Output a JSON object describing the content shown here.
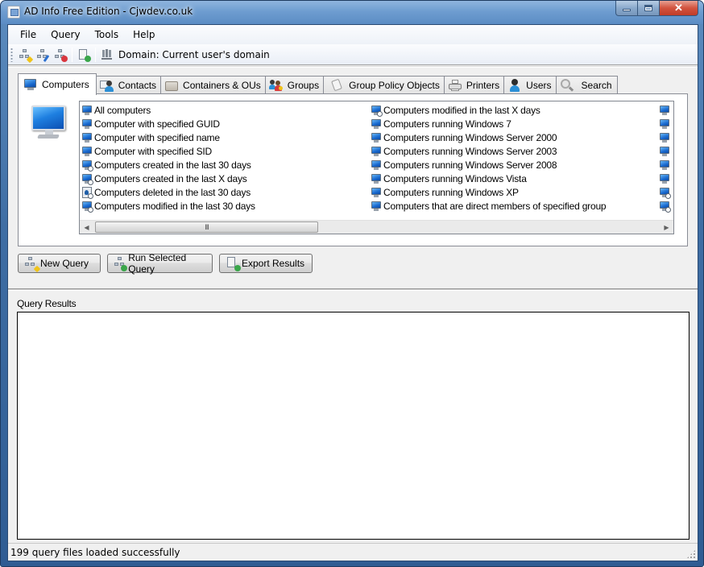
{
  "window": {
    "title": "AD Info Free Edition - Cjwdev.co.uk",
    "controls": {
      "minimize": "minimize",
      "maximize": "maximize",
      "close": "close"
    }
  },
  "menu": [
    {
      "label": "File"
    },
    {
      "label": "Query"
    },
    {
      "label": "Tools"
    },
    {
      "label": "Help"
    }
  ],
  "toolbar": {
    "buttons": [
      {
        "icon": "new-query-icon",
        "tooltip": "New Query"
      },
      {
        "icon": "edit-query-icon",
        "tooltip": "Edit Query"
      },
      {
        "icon": "delete-query-icon",
        "tooltip": "Delete Query"
      },
      {
        "icon": "export-icon",
        "tooltip": "Export Results"
      }
    ],
    "domain_icon": "domain-network-icon",
    "domain_label": "Domain: Current user's domain"
  },
  "tabs": [
    {
      "label": "Computers",
      "icon": "computer-icon",
      "active": true
    },
    {
      "label": "Contacts",
      "icon": "contact-icon",
      "active": false
    },
    {
      "label": "Containers & OUs",
      "icon": "folder-icon",
      "active": false
    },
    {
      "label": "Groups",
      "icon": "group-icon",
      "active": false
    },
    {
      "label": "Group Policy Objects",
      "icon": "gpo-icon",
      "active": false
    },
    {
      "label": "Printers",
      "icon": "printer-icon",
      "active": false
    },
    {
      "label": "Users",
      "icon": "user-icon",
      "active": false
    },
    {
      "label": "Search",
      "icon": "search-icon",
      "active": false
    }
  ],
  "queries": {
    "column1": [
      {
        "label": "All computers",
        "icon": "computer"
      },
      {
        "label": "Computer with specified GUID",
        "icon": "computer"
      },
      {
        "label": "Computer with specified name",
        "icon": "computer"
      },
      {
        "label": "Computer with specified SID",
        "icon": "computer"
      },
      {
        "label": "Computers created in the last 30 days",
        "icon": "computer-clock"
      },
      {
        "label": "Computers created in the last X days",
        "icon": "computer-clock"
      },
      {
        "label": "Computers deleted in the last 30 days",
        "icon": "deleted-clock"
      },
      {
        "label": "Computers modified in the last 30 days",
        "icon": "computer-clock"
      }
    ],
    "column2": [
      {
        "label": "Computers modified in the last X days",
        "icon": "computer-clock"
      },
      {
        "label": "Computers running Windows 7",
        "icon": "computer"
      },
      {
        "label": "Computers running Windows Server 2000",
        "icon": "computer"
      },
      {
        "label": "Computers running Windows Server 2003",
        "icon": "computer"
      },
      {
        "label": "Computers running Windows Server 2008",
        "icon": "computer"
      },
      {
        "label": "Computers running Windows Vista",
        "icon": "computer"
      },
      {
        "label": "Computers running Windows XP",
        "icon": "computer"
      },
      {
        "label": "Computers that are direct members of specified group",
        "icon": "computer"
      }
    ],
    "column3": [
      {
        "label": "",
        "icon": "computer"
      },
      {
        "label": "",
        "icon": "computer"
      },
      {
        "label": "",
        "icon": "computer"
      },
      {
        "label": "",
        "icon": "computer"
      },
      {
        "label": "",
        "icon": "computer"
      },
      {
        "label": "",
        "icon": "computer"
      },
      {
        "label": "",
        "icon": "computer-clock"
      },
      {
        "label": "",
        "icon": "computer-clock"
      }
    ],
    "scroll_thumb_grip": "III"
  },
  "actions": {
    "new_query": "New Query",
    "run_selected_query": "Run Selected Query",
    "export_results": "Export Results"
  },
  "results": {
    "label": "Query Results",
    "rows": []
  },
  "status": {
    "text": "199 query files loaded successfully"
  }
}
